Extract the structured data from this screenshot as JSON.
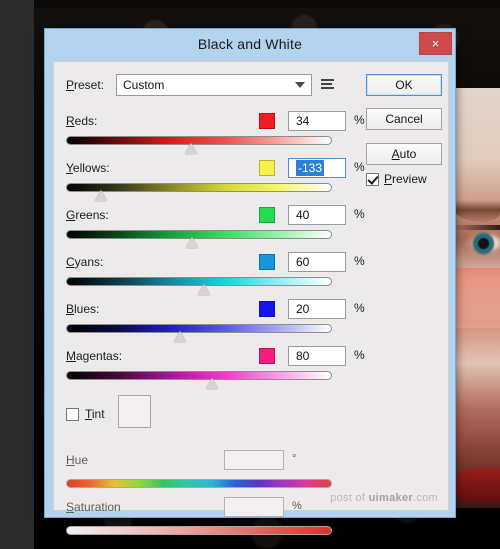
{
  "window": {
    "title": "Black and White",
    "close_label": "×"
  },
  "preset": {
    "label": "Preset:",
    "value": "Custom",
    "options_icon": "preset-options-icon",
    "arrow_icon": "chevron-down-icon"
  },
  "buttons": {
    "ok": "OK",
    "cancel": "Cancel",
    "auto": "Auto"
  },
  "preview": {
    "label": "Preview",
    "checked": true
  },
  "sliders": [
    {
      "label": "Reds:",
      "value": "34",
      "unit": "%",
      "swatch": "#ef1c24",
      "thumb_pct": 47,
      "focused": false
    },
    {
      "label": "Yellows:",
      "value": "-133",
      "unit": "%",
      "swatch": "#f7f14a",
      "thumb_pct": 13,
      "focused": true
    },
    {
      "label": "Greens:",
      "value": "40",
      "unit": "%",
      "swatch": "#22dd51",
      "thumb_pct": 47.5,
      "focused": false
    },
    {
      "label": "Cyans:",
      "value": "60",
      "unit": "%",
      "swatch": "#1597dc",
      "thumb_pct": 52,
      "focused": false
    },
    {
      "label": "Blues:",
      "value": "20",
      "unit": "%",
      "swatch": "#1515e8",
      "thumb_pct": 43,
      "focused": false
    },
    {
      "label": "Magentas:",
      "value": "80",
      "unit": "%",
      "swatch": "#f51b7f",
      "thumb_pct": 55,
      "focused": false
    }
  ],
  "tint": {
    "label": "Tint",
    "checked": false,
    "color": "#f1efef"
  },
  "hue": {
    "label": "Hue",
    "value": "",
    "unit": "°"
  },
  "saturation": {
    "label": "Saturation",
    "value": "",
    "unit": "%"
  },
  "watermark": {
    "prefix": "post of ",
    "brand": "uimaker",
    "suffix": ".com"
  }
}
